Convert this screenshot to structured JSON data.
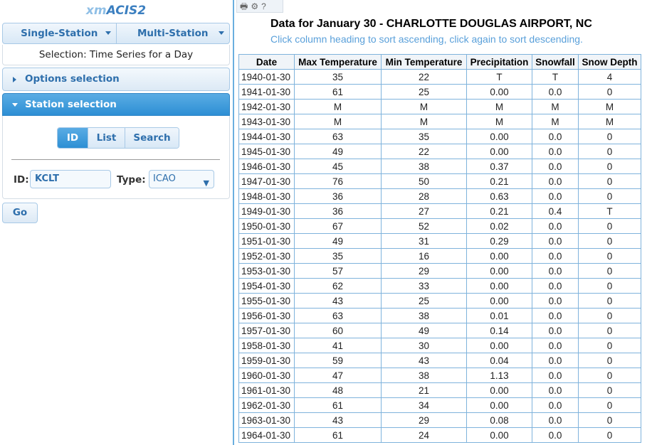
{
  "app": {
    "brand_prefix": "xm",
    "brand_main": "ACIS2"
  },
  "nav": {
    "single_station": "Single-Station",
    "multi_station": "Multi-Station"
  },
  "selection_label": "Selection: Time Series for a Day",
  "accordion": {
    "options": "Options selection",
    "station": "Station selection"
  },
  "station_picker": {
    "modes": [
      "ID",
      "List",
      "Search"
    ],
    "active_mode": "ID",
    "id_label": "ID:",
    "id_value": "KCLT",
    "type_label": "Type:",
    "type_value": "ICAO"
  },
  "go_label": "Go",
  "toolbar": {
    "icons": [
      "print-icon",
      "gear-icon",
      "help-icon"
    ]
  },
  "report": {
    "title": "Data for January 30 - CHARLOTTE DOUGLAS AIRPORT, NC",
    "subtitle": "Click column heading to sort ascending, click again to sort descending.",
    "columns": [
      "Date",
      "Max Temperature",
      "Min Temperature",
      "Precipitation",
      "Snowfall",
      "Snow Depth"
    ],
    "rows": [
      [
        "1940-01-30",
        "35",
        "22",
        "T",
        "T",
        "4"
      ],
      [
        "1941-01-30",
        "61",
        "25",
        "0.00",
        "0.0",
        "0"
      ],
      [
        "1942-01-30",
        "M",
        "M",
        "M",
        "M",
        "M"
      ],
      [
        "1943-01-30",
        "M",
        "M",
        "M",
        "M",
        "M"
      ],
      [
        "1944-01-30",
        "63",
        "35",
        "0.00",
        "0.0",
        "0"
      ],
      [
        "1945-01-30",
        "49",
        "22",
        "0.00",
        "0.0",
        "0"
      ],
      [
        "1946-01-30",
        "45",
        "38",
        "0.37",
        "0.0",
        "0"
      ],
      [
        "1947-01-30",
        "76",
        "50",
        "0.21",
        "0.0",
        "0"
      ],
      [
        "1948-01-30",
        "36",
        "28",
        "0.63",
        "0.0",
        "0"
      ],
      [
        "1949-01-30",
        "36",
        "27",
        "0.21",
        "0.4",
        "T"
      ],
      [
        "1950-01-30",
        "67",
        "52",
        "0.02",
        "0.0",
        "0"
      ],
      [
        "1951-01-30",
        "49",
        "31",
        "0.29",
        "0.0",
        "0"
      ],
      [
        "1952-01-30",
        "35",
        "16",
        "0.00",
        "0.0",
        "0"
      ],
      [
        "1953-01-30",
        "57",
        "29",
        "0.00",
        "0.0",
        "0"
      ],
      [
        "1954-01-30",
        "62",
        "33",
        "0.00",
        "0.0",
        "0"
      ],
      [
        "1955-01-30",
        "43",
        "25",
        "0.00",
        "0.0",
        "0"
      ],
      [
        "1956-01-30",
        "63",
        "38",
        "0.01",
        "0.0",
        "0"
      ],
      [
        "1957-01-30",
        "60",
        "49",
        "0.14",
        "0.0",
        "0"
      ],
      [
        "1958-01-30",
        "41",
        "30",
        "0.00",
        "0.0",
        "0"
      ],
      [
        "1959-01-30",
        "59",
        "43",
        "0.04",
        "0.0",
        "0"
      ],
      [
        "1960-01-30",
        "47",
        "38",
        "1.13",
        "0.0",
        "0"
      ],
      [
        "1961-01-30",
        "48",
        "21",
        "0.00",
        "0.0",
        "0"
      ],
      [
        "1962-01-30",
        "61",
        "34",
        "0.00",
        "0.0",
        "0"
      ],
      [
        "1963-01-30",
        "43",
        "29",
        "0.08",
        "0.0",
        "0"
      ],
      [
        "1964-01-30",
        "61",
        "24",
        "0.00",
        "0.0",
        "0"
      ]
    ]
  }
}
